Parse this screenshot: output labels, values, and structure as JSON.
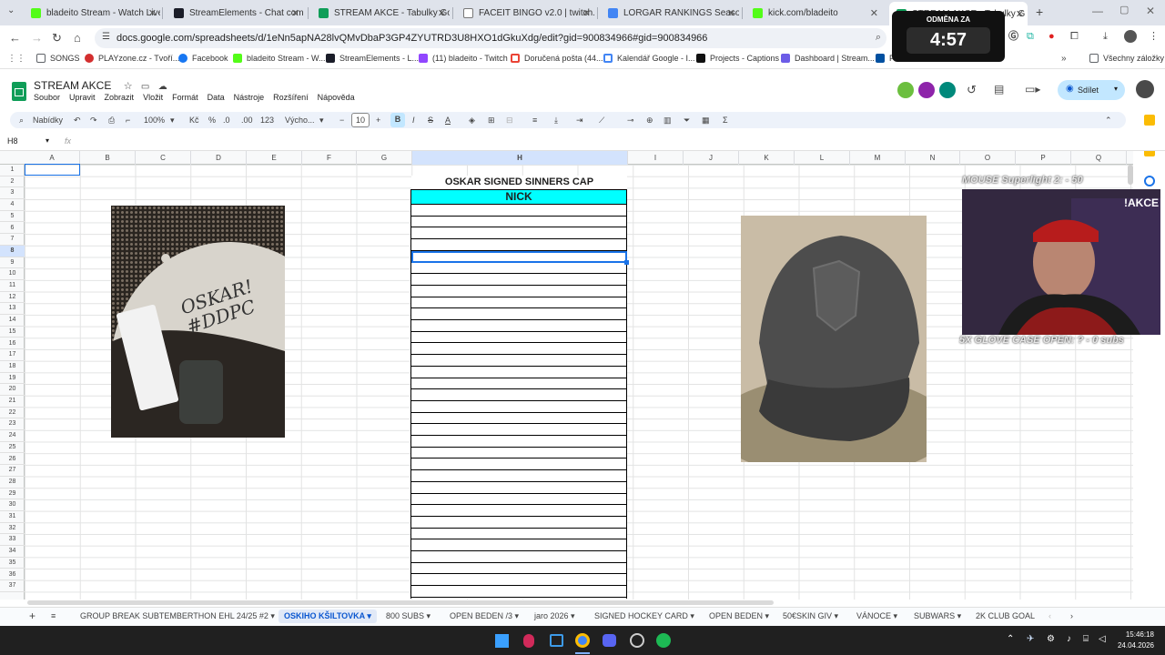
{
  "browser": {
    "tabs": [
      {
        "title": "bladeito Stream - Watch Live o",
        "icon": "kick-icon",
        "color": "#53fc18"
      },
      {
        "title": "StreamElements - Chat comma",
        "icon": "streamelements-icon",
        "color": "#1b1d29"
      },
      {
        "title": "STREAM AKCE - Tabulky Googl",
        "icon": "sheets-icon",
        "color": "#0f9d58"
      },
      {
        "title": "FACEIT BINGO v2.0 | twitch.tv/",
        "icon": "globe-icon",
        "color": "#777777"
      },
      {
        "title": "LORGAR RANKINGS Season 1",
        "icon": "sheets-icon",
        "color": "#4285f4"
      },
      {
        "title": "kick.com/bladeito",
        "icon": "kick-icon",
        "color": "#53fc18"
      },
      {
        "title": "STREAM AKCE - Tabulky G",
        "icon": "sheets-icon",
        "color": "#0f9d58"
      }
    ],
    "url": "docs.google.com/spreadsheets/d/1eNn5apNA28lvQMvDbaP3GP4ZYUTRD3U8HXO1dGkuXdg/edit?gid=900834966#gid=900834966",
    "bookmarks": [
      {
        "label": "SONGS",
        "color": "#5f6368"
      },
      {
        "label": "PLAYzone.cz - Tvoří...",
        "color": "#d32f2f"
      },
      {
        "label": "Facebook",
        "color": "#1877f2"
      },
      {
        "label": "bladeito Stream - W...",
        "color": "#53fc18"
      },
      {
        "label": "StreamElements - L...",
        "color": "#1b1d29"
      },
      {
        "label": "(11) bladeito - Twitch",
        "color": "#9146ff"
      },
      {
        "label": "Doručená pošta (44...",
        "color": "#ea4335"
      },
      {
        "label": "Kalendář Google - I...",
        "color": "#4285f4"
      },
      {
        "label": "Projects - Captions",
        "color": "#111111"
      },
      {
        "label": "Dashboard | Stream...",
        "color": "#6c5ce7"
      },
      {
        "label": "P...",
        "color": "#0050a0"
      }
    ],
    "all_bookmarks": "Všechny záložky"
  },
  "timer": {
    "label": "ODMĚNA ZA",
    "value": "4:57"
  },
  "sheets": {
    "title": "STREAM AKCE",
    "menu": [
      "Soubor",
      "Upravit",
      "Zobrazit",
      "Vložit",
      "Formát",
      "Data",
      "Nástroje",
      "Rozšíření",
      "Nápověda"
    ],
    "share_label": "Sdílet",
    "toolbar": {
      "menus": "Nabídky",
      "zoom": "100%",
      "currency": "Kč",
      "percent": "%",
      "dec_less": ".0",
      "dec_more": ".00",
      "number_fmt": "123",
      "font": "Výcho...",
      "font_size": "10"
    },
    "name_box": "H8",
    "fx": "fx",
    "columns": [
      "A",
      "B",
      "C",
      "D",
      "E",
      "F",
      "G",
      "H",
      "I",
      "J",
      "K",
      "L",
      "M",
      "N",
      "O",
      "P",
      "Q"
    ],
    "rows": [
      "1",
      "2",
      "3",
      "4",
      "5",
      "6",
      "7",
      "8",
      "9",
      "10",
      "11",
      "12",
      "13",
      "14",
      "15",
      "16",
      "17",
      "18",
      "19",
      "20",
      "21",
      "22",
      "23",
      "24",
      "25",
      "26",
      "27",
      "28",
      "29",
      "30",
      "31",
      "32",
      "33",
      "34",
      "35",
      "36",
      "37"
    ],
    "cap_title": "OSKAR SIGNED SINNERS CAP",
    "nick_header": "NICK",
    "nick_header_color": "#00ffff",
    "left_image_text": "OSKAR! #DDPC",
    "sheet_tabs": [
      "GROUP BREAK SUBTEMBERTHON EHL 24/25 #2",
      "OSKIHO KŠILTOVKA",
      "800 SUBS",
      "OPEN BEDEN /3",
      "jaro 2026",
      "SIGNED HOCKEY CARD",
      "OPEN BEDEN",
      "50€SKIN GIV",
      "VÁNOCE",
      "SUBWARS",
      "2K CLUB GOAL"
    ]
  },
  "stream_overlay": {
    "top_text": "MOUSE Superlight 2: - 50",
    "akce_text": "!AKCE",
    "bottom_text": "5X GLOVE CASE OPEN: ? - 0 subs"
  },
  "taskbar": {
    "time": "15:46:18",
    "date": "24.04.2026"
  }
}
